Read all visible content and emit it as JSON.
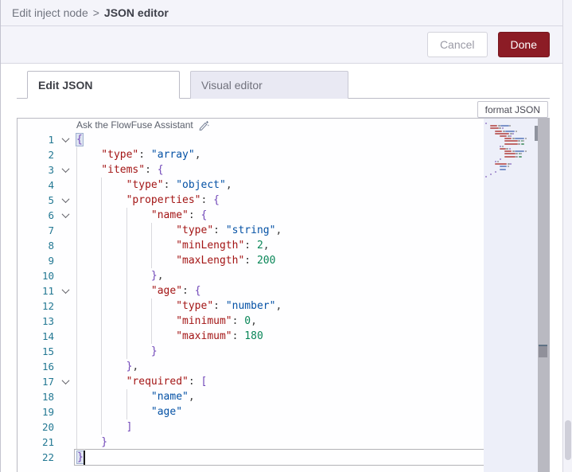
{
  "breadcrumb": {
    "parent": "Edit inject node",
    "separator": ">",
    "current": "JSON editor"
  },
  "actions": {
    "cancel": "Cancel",
    "done": "Done"
  },
  "tabs": [
    {
      "label": "Edit JSON",
      "active": true
    },
    {
      "label": "Visual editor",
      "active": false
    }
  ],
  "toolbar": {
    "format_button": "format JSON"
  },
  "editor": {
    "assistant_hint": "Ask the FlowFuse Assistant",
    "cursor_line": 22,
    "lines": [
      {
        "n": 1,
        "fold": true,
        "ind": 0,
        "t": [
          [
            "brace",
            "{",
            "match"
          ]
        ]
      },
      {
        "n": 2,
        "ind": 1,
        "t": [
          [
            "key",
            "\"type\""
          ],
          [
            "punct",
            ": "
          ],
          [
            "str",
            "\"array\""
          ],
          [
            "punct",
            ","
          ]
        ]
      },
      {
        "n": 3,
        "fold": true,
        "ind": 1,
        "t": [
          [
            "key",
            "\"items\""
          ],
          [
            "punct",
            ": "
          ],
          [
            "brace",
            "{"
          ]
        ]
      },
      {
        "n": 4,
        "ind": 2,
        "t": [
          [
            "key",
            "\"type\""
          ],
          [
            "punct",
            ": "
          ],
          [
            "str",
            "\"object\""
          ],
          [
            "punct",
            ","
          ]
        ]
      },
      {
        "n": 5,
        "fold": true,
        "ind": 2,
        "t": [
          [
            "key",
            "\"properties\""
          ],
          [
            "punct",
            ": "
          ],
          [
            "brace",
            "{"
          ]
        ]
      },
      {
        "n": 6,
        "fold": true,
        "ind": 3,
        "t": [
          [
            "key",
            "\"name\""
          ],
          [
            "punct",
            ": "
          ],
          [
            "brace",
            "{"
          ]
        ]
      },
      {
        "n": 7,
        "ind": 4,
        "t": [
          [
            "key",
            "\"type\""
          ],
          [
            "punct",
            ": "
          ],
          [
            "str",
            "\"string\""
          ],
          [
            "punct",
            ","
          ]
        ]
      },
      {
        "n": 8,
        "ind": 4,
        "t": [
          [
            "key",
            "\"minLength\""
          ],
          [
            "punct",
            ": "
          ],
          [
            "num",
            "2"
          ],
          [
            "punct",
            ","
          ]
        ]
      },
      {
        "n": 9,
        "ind": 4,
        "t": [
          [
            "key",
            "\"maxLength\""
          ],
          [
            "punct",
            ": "
          ],
          [
            "num",
            "200"
          ]
        ]
      },
      {
        "n": 10,
        "ind": 3,
        "t": [
          [
            "brace",
            "}"
          ],
          [
            "punct",
            ","
          ]
        ]
      },
      {
        "n": 11,
        "fold": true,
        "ind": 3,
        "t": [
          [
            "key",
            "\"age\""
          ],
          [
            "punct",
            ": "
          ],
          [
            "brace",
            "{"
          ]
        ]
      },
      {
        "n": 12,
        "ind": 4,
        "t": [
          [
            "key",
            "\"type\""
          ],
          [
            "punct",
            ": "
          ],
          [
            "str",
            "\"number\""
          ],
          [
            "punct",
            ","
          ]
        ]
      },
      {
        "n": 13,
        "ind": 4,
        "t": [
          [
            "key",
            "\"minimum\""
          ],
          [
            "punct",
            ": "
          ],
          [
            "num",
            "0"
          ],
          [
            "punct",
            ","
          ]
        ]
      },
      {
        "n": 14,
        "ind": 4,
        "t": [
          [
            "key",
            "\"maximum\""
          ],
          [
            "punct",
            ": "
          ],
          [
            "num",
            "180"
          ]
        ]
      },
      {
        "n": 15,
        "ind": 3,
        "t": [
          [
            "brace",
            "}"
          ]
        ]
      },
      {
        "n": 16,
        "ind": 2,
        "t": [
          [
            "brace",
            "}"
          ],
          [
            "punct",
            ","
          ]
        ]
      },
      {
        "n": 17,
        "fold": true,
        "ind": 2,
        "t": [
          [
            "key",
            "\"required\""
          ],
          [
            "punct",
            ": "
          ],
          [
            "brace",
            "["
          ]
        ]
      },
      {
        "n": 18,
        "ind": 3,
        "t": [
          [
            "str",
            "\"name\""
          ],
          [
            "punct",
            ","
          ]
        ]
      },
      {
        "n": 19,
        "ind": 3,
        "t": [
          [
            "str",
            "\"age\""
          ]
        ]
      },
      {
        "n": 20,
        "ind": 2,
        "t": [
          [
            "brace",
            "]"
          ]
        ]
      },
      {
        "n": 21,
        "ind": 1,
        "t": [
          [
            "brace",
            "}"
          ]
        ]
      },
      {
        "n": 22,
        "ind": 0,
        "t": [
          [
            "brace",
            "}",
            "match"
          ]
        ],
        "current": true
      }
    ]
  },
  "colors": {
    "done_button": "#8C1C25",
    "syntax": {
      "key": "#A31515",
      "str": "#0451A5",
      "num": "#098658",
      "brace": "#7046B8",
      "punct": "#3B3B3B",
      "line_number": "#237893"
    },
    "minimap": {
      "key": "#C06969",
      "str": "#7B93C9",
      "num": "#63A07E",
      "brace": "#9A82C9",
      "punct": "#9B9B9B"
    }
  }
}
